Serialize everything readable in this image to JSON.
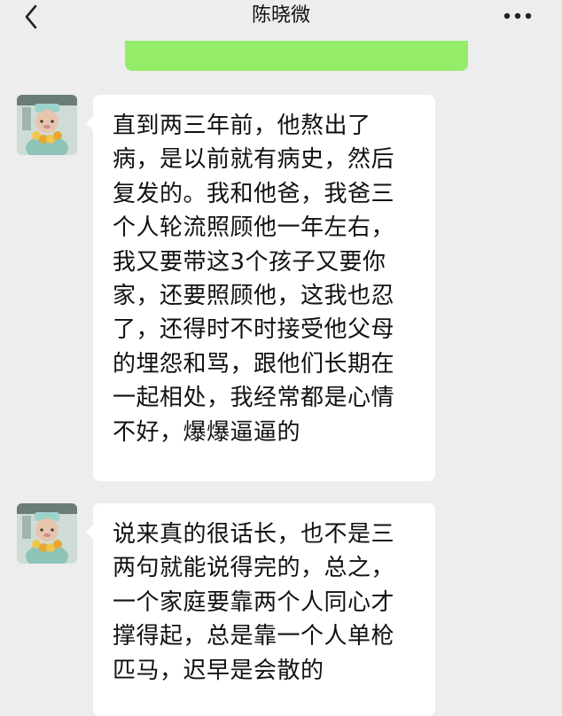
{
  "header": {
    "title": "陈晓微",
    "back_icon": "chevron-left-icon",
    "more_icon": "more-dots-icon"
  },
  "colors": {
    "background": "#ededed",
    "received_bubble": "#ffffff",
    "sent_bubble": "#95ec69"
  },
  "messages": [
    {
      "sender": "received",
      "lines": [
        "直到两三年前，他熬出了",
        "病，是以前就有病史，然后",
        "复发的。我和他爸，我爸三",
        "个人轮流照顾他一年左右，",
        "我又要带这3个孩子又要你",
        "家，还要照顾他，这我也忍",
        "了，还得时不时接受他父母",
        "的埋怨和骂，跟他们长期在",
        "一起相处，我经常都是心情",
        "不好，爆爆逼逼的"
      ]
    },
    {
      "sender": "received",
      "lines": [
        "说来真的很话长，也不是三",
        "两句就能说得完的，总之，",
        "一个家庭要靠两个人同心才",
        "撑得起，总是靠一个人单枪",
        "匹马，迟早是会散的"
      ]
    }
  ]
}
